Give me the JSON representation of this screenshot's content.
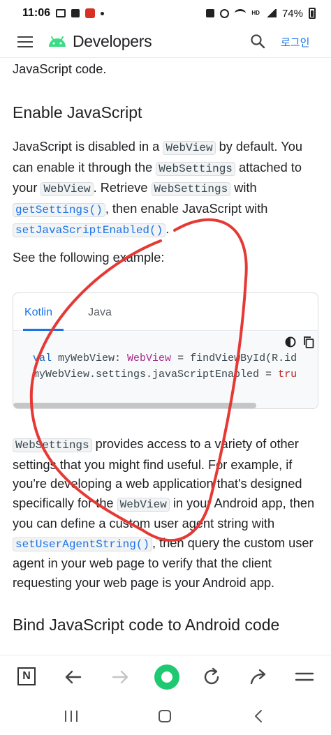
{
  "status_bar": {
    "time": "11:06",
    "hd_label": "HD",
    "battery": "74%"
  },
  "top_bar": {
    "brand": "Developers",
    "login": "로그인",
    "icons": [
      "menu-icon",
      "android-logo-icon",
      "search-icon"
    ]
  },
  "content": {
    "prev_fragment": "JavaScript code.",
    "section1_title": "Enable JavaScript",
    "p1": [
      {
        "t": "text",
        "v": "JavaScript is disabled in a "
      },
      {
        "t": "code",
        "v": "WebView"
      },
      {
        "t": "text",
        "v": " by default. You can enable it through the "
      },
      {
        "t": "code",
        "v": "WebSettings"
      },
      {
        "t": "text",
        "v": " attached to your "
      },
      {
        "t": "code",
        "v": "WebView"
      },
      {
        "t": "text",
        "v": ". Retrieve "
      },
      {
        "t": "code",
        "v": "WebSettings"
      },
      {
        "t": "text",
        "v": " with "
      },
      {
        "t": "link",
        "v": "getSettings()"
      },
      {
        "t": "text",
        "v": ", then enable JavaScript with "
      },
      {
        "t": "link",
        "v": "setJavaScriptEnabled()"
      },
      {
        "t": "text",
        "v": "."
      }
    ],
    "p2": "See the following example:",
    "code_sample": {
      "tabs": [
        "Kotlin",
        "Java"
      ],
      "active_tab": "Kotlin",
      "line1": {
        "kw": "val",
        "a": " myWebView: ",
        "type": "WebView",
        "b": " = findViewById(R.id"
      },
      "line2": {
        "a": "myWebView.settings.javaScriptEnabled = ",
        "bool": "tru"
      },
      "tools": [
        "theme-toggle-icon",
        "copy-icon"
      ]
    },
    "p3": [
      {
        "t": "code",
        "v": "WebSettings"
      },
      {
        "t": "text",
        "v": " provides access to a variety of other settings that you might find useful. For example, if you're developing a web application that's designed specifically for the "
      },
      {
        "t": "code",
        "v": "WebView"
      },
      {
        "t": "text",
        "v": " in your Android app, then you can define a custom user agent string with "
      },
      {
        "t": "link",
        "v": "setUserAgentString()"
      },
      {
        "t": "text",
        "v": ", then query the custom user agent in your web page to verify that the client requesting your web page is your Android app."
      }
    ],
    "section2_title": "Bind JavaScript code to Android code"
  },
  "browser_bar": {
    "tabs_label": "N",
    "buttons": [
      "tabs-button",
      "back-button",
      "forward-button",
      "home-button",
      "reload-button",
      "share-button",
      "menu-button"
    ]
  },
  "system_nav": {
    "buttons": [
      "recents-button",
      "home-nav-button",
      "back-nav-button"
    ]
  },
  "colors": {
    "accent": "#1a73e8",
    "android_green": "#3ddc84",
    "annotation_red": "#e53935",
    "browser_home": "#1ec971"
  }
}
